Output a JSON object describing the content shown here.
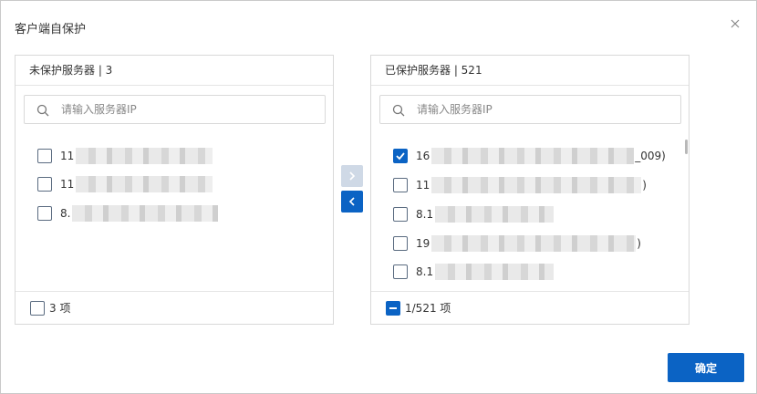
{
  "dialog": {
    "title": "客户端自保护",
    "close_icon": "close-icon"
  },
  "left_panel": {
    "header": "未保护服务器 | 3",
    "search_placeholder": "请输入服务器IP",
    "items": [
      {
        "prefix": "11",
        "suffix": "",
        "checked": false
      },
      {
        "prefix": "11",
        "suffix": "",
        "checked": false
      },
      {
        "prefix": "8.",
        "suffix": "",
        "checked": false
      }
    ],
    "footer_count": "3 项",
    "footer_state": "unchecked"
  },
  "right_panel": {
    "header": "已保护服务器 | 521",
    "search_placeholder": "请输入服务器IP",
    "items": [
      {
        "prefix": "16",
        "suffix": "_009)",
        "checked": true
      },
      {
        "prefix": "11",
        "suffix": ")",
        "checked": false
      },
      {
        "prefix": "8.1",
        "suffix": "",
        "checked": false
      },
      {
        "prefix": "19",
        "suffix": ")",
        "checked": false
      },
      {
        "prefix": "8.1",
        "suffix": "",
        "checked": false
      }
    ],
    "footer_count": "1/521 项",
    "footer_state": "partial"
  },
  "transfer": {
    "to_right_icon": "chevron-right-icon",
    "to_left_icon": "chevron-left-icon"
  },
  "footer": {
    "confirm_label": "确定"
  },
  "colors": {
    "primary": "#0b63c4",
    "disabled_arrow": "#cfd9e6",
    "border": "#d9d9d9"
  }
}
